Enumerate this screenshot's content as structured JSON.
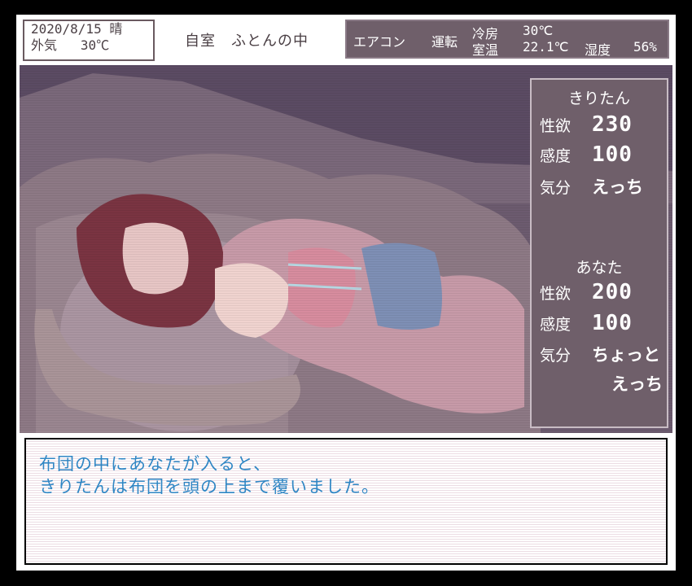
{
  "datetime": {
    "date": "2020/8/15",
    "weather": "晴",
    "outside_label": "外気",
    "outside_temp": "30℃"
  },
  "location": "自室　ふとんの中",
  "aircon": {
    "label": "エアコン",
    "status": "運転",
    "mode": "冷房",
    "set_temp": "30℃",
    "room_label": "室温",
    "room_temp": "22.1℃",
    "humidity_label": "湿度",
    "humidity": "56%"
  },
  "stats": {
    "kiritan": {
      "name": "きりたん",
      "lust_label": "性欲",
      "lust": "230",
      "sense_label": "感度",
      "sense": "100",
      "mood_label": "気分",
      "mood": "えっち"
    },
    "you": {
      "name": "あなた",
      "lust_label": "性欲",
      "lust": "200",
      "sense_label": "感度",
      "sense": "100",
      "mood_label": "気分",
      "mood_line1": "ちょっと",
      "mood_line2": "えっち"
    }
  },
  "message": {
    "line1": "布団の中にあなたが入ると、",
    "line2": "きりたんは布団を頭の上まで覆いました。"
  }
}
